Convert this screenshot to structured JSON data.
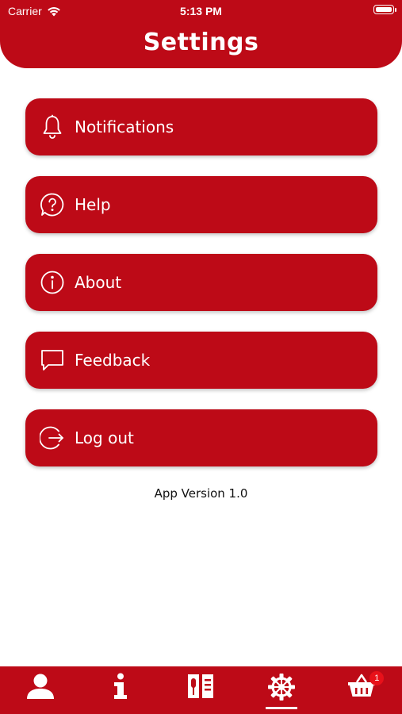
{
  "status_bar": {
    "carrier": "Carrier",
    "time": "5:13 PM"
  },
  "header": {
    "title": "Settings"
  },
  "menu": {
    "items": [
      {
        "label": "Notifications",
        "icon": "bell-icon"
      },
      {
        "label": "Help",
        "icon": "help-icon"
      },
      {
        "label": "About",
        "icon": "info-icon"
      },
      {
        "label": "Feedback",
        "icon": "chat-icon"
      },
      {
        "label": "Log out",
        "icon": "logout-icon"
      }
    ]
  },
  "footer": {
    "version": "App Version 1.0"
  },
  "tabbar": {
    "tabs": [
      {
        "icon": "user-icon",
        "active": false
      },
      {
        "icon": "info-icon",
        "active": false
      },
      {
        "icon": "menu-book-icon",
        "active": false
      },
      {
        "icon": "gear-icon",
        "active": true
      },
      {
        "icon": "basket-icon",
        "active": false,
        "badge": "1"
      }
    ]
  },
  "colors": {
    "brand": "#bd0a17",
    "badge": "#e8111a",
    "text_on_brand": "#ffffff"
  }
}
